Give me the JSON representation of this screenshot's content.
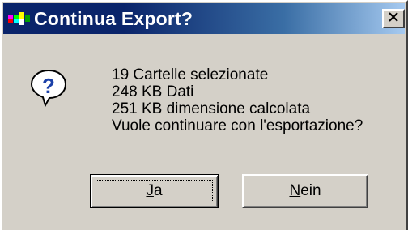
{
  "window": {
    "title": "Continua Export?",
    "close_glyph": "✕"
  },
  "icons": {
    "app": "app-colored-blocks-icon",
    "message": "question-icon",
    "close": "close-icon"
  },
  "message": {
    "lines": [
      "19 Cartelle selezionate",
      "248 KB Dati",
      "251 KB dimensione calcolata",
      "Vuole continuare con l'esportazione?"
    ]
  },
  "buttons": {
    "yes": {
      "mnemonic": "J",
      "rest": "a",
      "is_default": true
    },
    "no": {
      "mnemonic": "N",
      "rest": "ein",
      "is_default": false
    }
  },
  "colors": {
    "face": "#d4d0c8",
    "title_start": "#0a246a",
    "title_end": "#a6caf0",
    "icon_blue": "#1a40a8"
  }
}
